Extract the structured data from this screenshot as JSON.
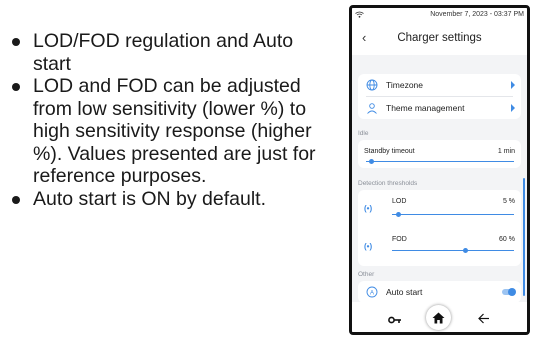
{
  "bullets": [
    "LOD/FOD regulation and Auto start",
    "LOD and FOD can be adjusted from low sensitivity (lower %) to high sensitivity response (higher %). Values presented are just for reference purposes.",
    "Auto start is ON by default."
  ],
  "statusbar": {
    "time": "November 7, 2023 - 03:37 PM",
    "icon": "wifi-icon"
  },
  "header": {
    "title": "Charger settings",
    "back_icon": "chevron-left-icon"
  },
  "menu": {
    "timezone": {
      "label": "Timezone",
      "icon": "globe-icon"
    },
    "theme": {
      "label": "Theme management",
      "icon": "person-icon"
    }
  },
  "idle": {
    "section_label": "Idle",
    "standby": {
      "label": "Standby timeout",
      "value": "1 min",
      "level": 0.04
    }
  },
  "detection": {
    "section_label": "Detection thresholds",
    "lod": {
      "label": "LOD",
      "value": "5 %",
      "level": 0.05,
      "icon": "signal-icon"
    },
    "fod": {
      "label": "FOD",
      "value": "60 %",
      "level": 0.6,
      "icon": "signal-icon"
    }
  },
  "other": {
    "section_label": "Other",
    "auto_start": {
      "label": "Auto start",
      "icon": "auto-start-icon",
      "enabled": true
    }
  },
  "bottom_nav": {
    "icons": [
      "key-icon",
      "home-icon",
      "arrow-left-icon"
    ]
  },
  "colors": {
    "accent": "#3f8be4",
    "background": "#f3f4f6"
  }
}
